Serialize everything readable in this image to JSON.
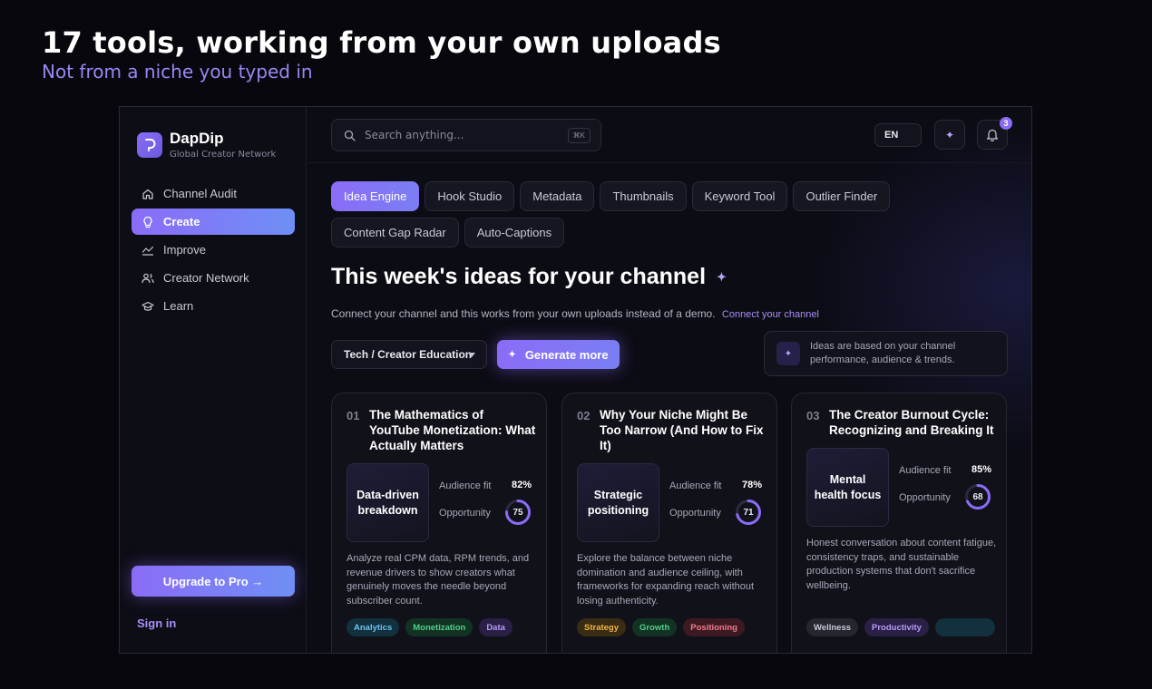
{
  "hero": {
    "title": "17 tools, working from your own uploads",
    "subtitle": "Not from a niche you typed in"
  },
  "brand": {
    "name": "DapDip",
    "tagline": "Global Creator Network",
    "accent": "#8b6cf7"
  },
  "sidebar": {
    "items": [
      {
        "label": "Channel Audit",
        "icon": "home-icon",
        "active": false
      },
      {
        "label": "Create",
        "icon": "lightbulb-icon",
        "active": true
      },
      {
        "label": "Improve",
        "icon": "chart-line-icon",
        "active": false
      },
      {
        "label": "Creator Network",
        "icon": "users-icon",
        "active": false
      },
      {
        "label": "Learn",
        "icon": "graduation-cap-icon",
        "active": false
      }
    ],
    "upgrade_label": "Upgrade to Pro →",
    "signin_label": "Sign in"
  },
  "topbar": {
    "search_placeholder": "Search anything...",
    "search_shortcut": "⌘K",
    "language": "EN",
    "notification_count": "3"
  },
  "tabs": [
    {
      "label": "Idea Engine",
      "active": true
    },
    {
      "label": "Hook Studio",
      "active": false
    },
    {
      "label": "Metadata",
      "active": false
    },
    {
      "label": "Thumbnails",
      "active": false
    },
    {
      "label": "Keyword Tool",
      "active": false
    },
    {
      "label": "Outlier Finder",
      "active": false
    },
    {
      "label": "Content Gap Radar",
      "active": false
    },
    {
      "label": "Auto-Captions",
      "active": false
    }
  ],
  "section": {
    "title": "This week's ideas for your channel",
    "connect_text": "Connect your channel and this works from your own uploads instead of a demo.",
    "connect_link": "Connect your channel",
    "niche_value": "Tech / Creator Education",
    "generate_label": "Generate more",
    "info_text": "Ideas are based on your channel performance, audience & trends."
  },
  "cards": [
    {
      "num": "01",
      "title": "The Mathematics of YouTube Monetization: What Actually Matters",
      "thumb": "Data-driven breakdown",
      "audience_label": "Audience fit",
      "audience_fit": "82%",
      "opportunity_label": "Opportunity",
      "opportunity": 75,
      "opportunity_text": "75",
      "description": "Analyze real CPM data, RPM trends, and revenue drivers to show creators what genuinely moves the needle beyond subscriber count.",
      "tags": [
        {
          "label": "Analytics",
          "color": "#6cc4ee",
          "bg": "#12303d"
        },
        {
          "label": "Monetization",
          "color": "#4fd08a",
          "bg": "#123323"
        },
        {
          "label": "Data",
          "color": "#b79cf6",
          "bg": "#2a1f45"
        }
      ]
    },
    {
      "num": "02",
      "title": "Why Your Niche Might Be Too Narrow (And How to Fix It)",
      "thumb": "Strategic positioning",
      "audience_label": "Audience fit",
      "audience_fit": "78%",
      "opportunity_label": "Opportunity",
      "opportunity": 71,
      "opportunity_text": "71",
      "description": "Explore the balance between niche domination and audience ceiling, with frameworks for expanding reach without losing authenticity.",
      "tags": [
        {
          "label": "Strategy",
          "color": "#f0b445",
          "bg": "#3a2c12"
        },
        {
          "label": "Growth",
          "color": "#4fd08a",
          "bg": "#123323"
        },
        {
          "label": "Positioning",
          "color": "#f27a8e",
          "bg": "#3d1a22"
        }
      ]
    },
    {
      "num": "03",
      "title": "The Creator Burnout Cycle: Recognizing and Breaking It",
      "thumb": "Mental health focus",
      "audience_label": "Audience fit",
      "audience_fit": "85%",
      "opportunity_label": "Opportunity",
      "opportunity": 68,
      "opportunity_text": "68",
      "description": "Honest conversation about content fatigue, consistency traps, and sustainable production systems that don't sacrifice wellbeing.",
      "tags": [
        {
          "label": "Wellness",
          "color": "#c9c9d6",
          "bg": "#26262f"
        },
        {
          "label": "Productivity",
          "color": "#b79cf6",
          "bg": "#2a1f45"
        },
        {
          "label": "",
          "color": "#6cc4ee",
          "bg": "#12303d"
        }
      ]
    }
  ]
}
